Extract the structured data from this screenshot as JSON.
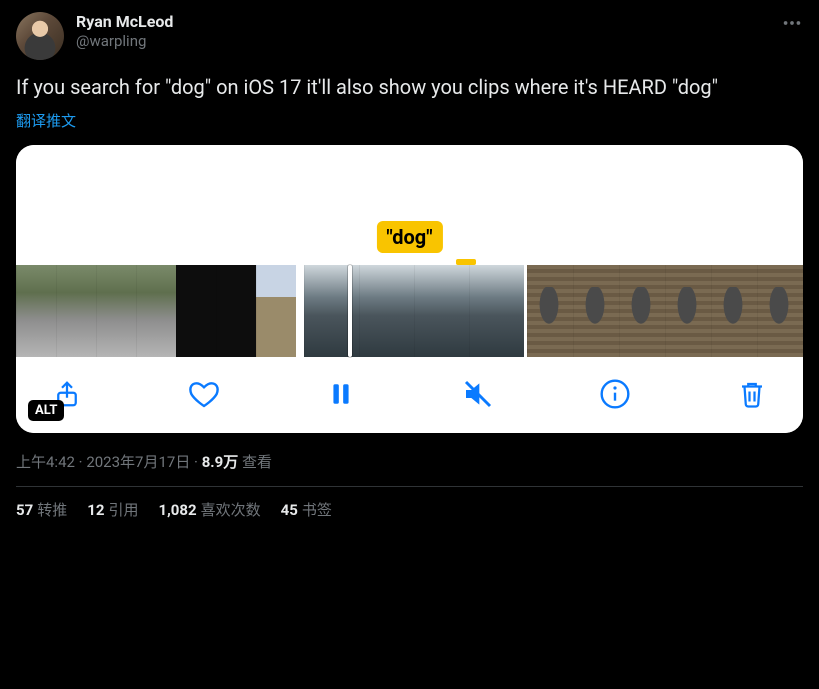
{
  "author": {
    "display_name": "Ryan McLeod",
    "handle": "@warpling"
  },
  "tweet_text": "If you search for \"dog\" on iOS 17 it'll also show you clips where it's HEARD \"dog\"",
  "translate_label": "翻译推文",
  "media": {
    "caption_text": "\"dog\"",
    "alt_badge": "ALT",
    "toolbar_icons": {
      "share": "share-icon",
      "heart": "heart-icon",
      "pause": "pause-icon",
      "mute": "mute-icon",
      "info": "info-icon",
      "trash": "trash-icon"
    }
  },
  "meta": {
    "time": "上午4:42",
    "date": "2023年7月17日",
    "separator": " · ",
    "views_count": "8.9万",
    "views_label": "查看"
  },
  "stats": {
    "retweets_count": "57",
    "retweets_label": "转推",
    "quotes_count": "12",
    "quotes_label": "引用",
    "likes_count": "1,082",
    "likes_label": "喜欢次数",
    "bookmarks_count": "45",
    "bookmarks_label": "书签"
  }
}
